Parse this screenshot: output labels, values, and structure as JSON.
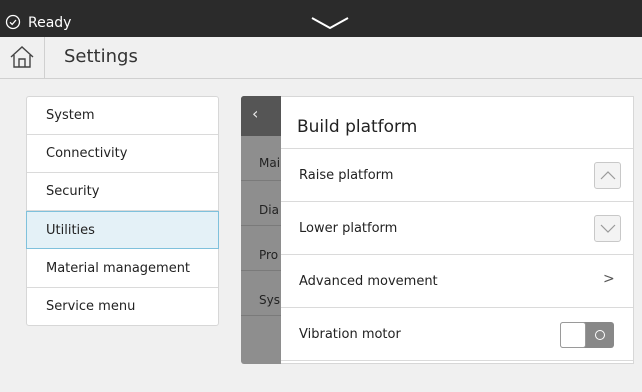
{
  "status": {
    "text": "Ready"
  },
  "header": {
    "title": "Settings"
  },
  "settings_menu": {
    "items": [
      {
        "label": "System"
      },
      {
        "label": "Connectivity"
      },
      {
        "label": "Security"
      },
      {
        "label": "Utilities",
        "selected": true
      },
      {
        "label": "Material management"
      },
      {
        "label": "Service menu"
      }
    ]
  },
  "utilities_menu": {
    "items": [
      {
        "label": "Mai"
      },
      {
        "label": "Dia"
      },
      {
        "label": "Pro"
      },
      {
        "label": "Sys"
      }
    ]
  },
  "build_platform": {
    "title": "Build platform",
    "raise_label": "Raise platform",
    "lower_label": "Lower platform",
    "advanced_label": "Advanced movement",
    "advanced_chevron": ">",
    "vibration_label": "Vibration motor",
    "vibration_on": false
  },
  "colors": {
    "statusbar": "#2b2b2b",
    "selected_bg": "#e4f1f7",
    "selected_border": "#7fc1dc",
    "panel_dark": "#8e8e8e"
  }
}
